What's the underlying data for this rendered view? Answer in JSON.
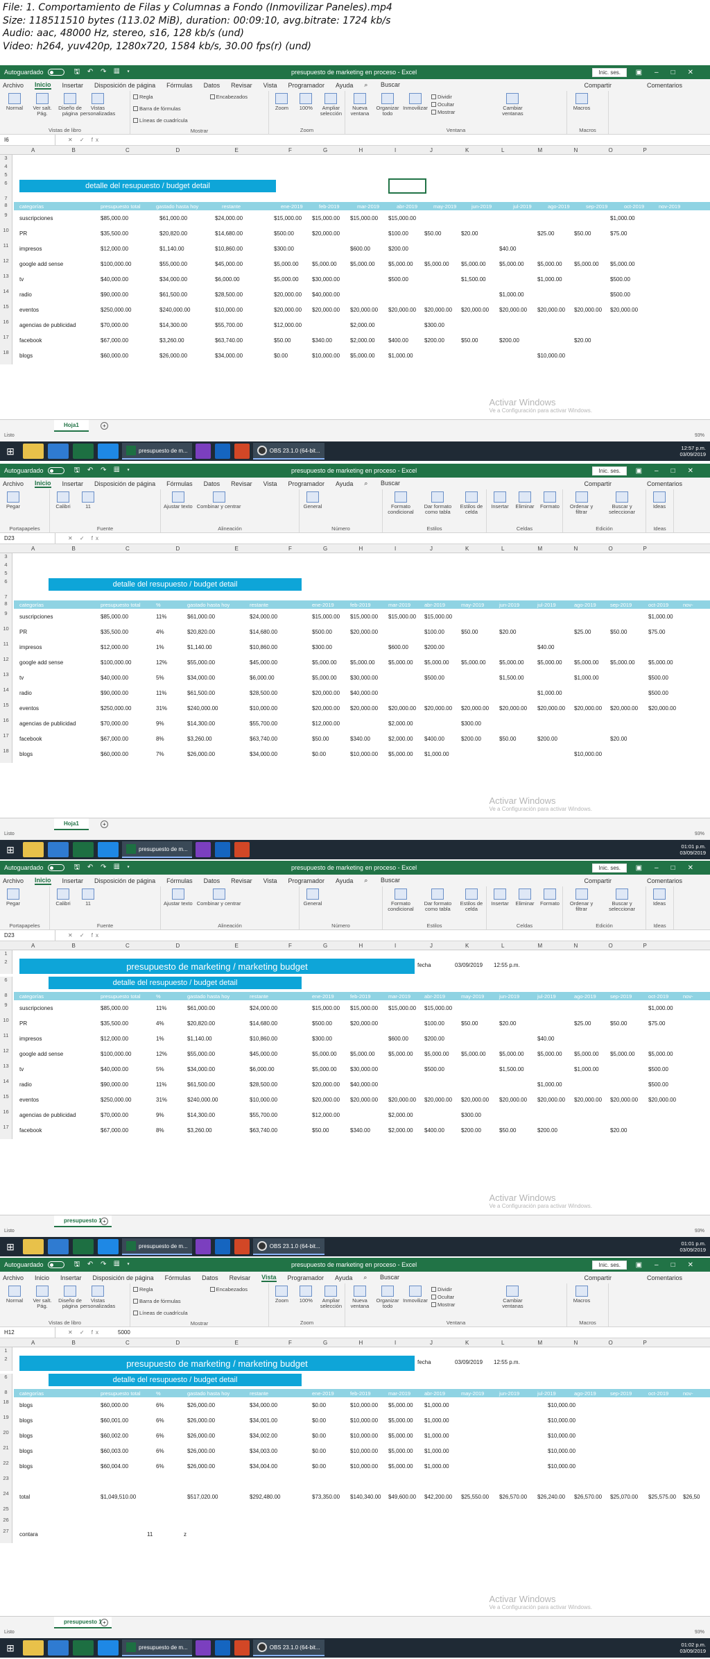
{
  "header": {
    "file": "File: 1. Comportamiento de Filas y Columnas a Fondo (Inmovilizar Paneles).mp4",
    "size": "Size: 118511510 bytes (113.02 MiB), duration: 00:09:10, avg.bitrate: 1724 kb/s",
    "audio": "Audio: aac, 48000 Hz, stereo, s16, 128 kb/s (und)",
    "video": "Video: h264, yuv420p, 1280x720, 1584 kb/s, 30.00 fps(r) (und)"
  },
  "app": {
    "autosave": "Autoguardado",
    "doc": "presupuesto de marketing en proceso - Excel",
    "signin": "Inic. ses.",
    "share": "Compartir",
    "comments": "Comentarios",
    "search": "Buscar"
  },
  "tabs": [
    "Archivo",
    "Inicio",
    "Insertar",
    "Disposición de página",
    "Fórmulas",
    "Datos",
    "Revisar",
    "Vista",
    "Programador",
    "Ayuda"
  ],
  "vista_groups": [
    "Vistas de libro",
    "Mostrar",
    "Zoom",
    "Ventana",
    "Macros"
  ],
  "vista_btns": [
    "Normal",
    "Ver salt. Pág.",
    "Diseño de página",
    "Vistas personalizadas",
    "Zoom",
    "100%",
    "Ampliar selección",
    "Nueva ventana",
    "Organizar todo",
    "Inmovilizar",
    "Cambiar ventanas",
    "Macros"
  ],
  "vista_checks": [
    "Regla",
    "Barra de fórmulas",
    "Líneas de cuadrícula",
    "Encabezados",
    "Dividir",
    "Ocultar",
    "Mostrar"
  ],
  "inicio_groups": [
    "Portapapeles",
    "Fuente",
    "Alineación",
    "Número",
    "Estilos",
    "Celdas",
    "Edición",
    "Ideas"
  ],
  "inicio_btns": [
    "Pegar",
    "Calibri",
    "11",
    "Ajustar texto",
    "Combinar y centrar",
    "General",
    "Formato condicional",
    "Dar formato como tabla",
    "Estilos de celda",
    "Insertar",
    "Eliminar",
    "Formato",
    "Ordenar y filtrar",
    "Buscar y seleccionar",
    "Ideas"
  ],
  "frames": [
    {
      "namebox": "I6",
      "formula": "",
      "tab": "Inicio"
    },
    {
      "namebox": "D23",
      "formula": "",
      "tab": "Inicio"
    },
    {
      "namebox": "D23",
      "formula": "",
      "tab": "Inicio"
    },
    {
      "namebox": "H12",
      "formula": "5000",
      "tab": "Vista"
    }
  ],
  "sheet1": "Hoja1",
  "sheet2": "presupuesto 1",
  "status": "Listo",
  "zoom": "93%",
  "watermark": {
    "title": "Activar Windows",
    "sub": "Ve a Configuración para activar Windows."
  },
  "taskbar": {
    "excel": "presupuesto de m...",
    "obs": "OBS 23.1.0 (64-bit...",
    "time": "12:57 p.m.",
    "date": "03/09/2019",
    "time2": "01:01 p.m.",
    "time3": "01:02 p.m."
  },
  "banner_main": "presupuesto de marketing / marketing budget",
  "banner_detail": "detalle del resupuesto / budget detail",
  "fecha": {
    "label": "fecha",
    "date": "03/09/2019",
    "time": "12:55 p.m."
  },
  "cols_f1": [
    "A",
    "B",
    "C",
    "D",
    "E",
    "F",
    "G",
    "H",
    "I",
    "J",
    "K",
    "L",
    "M",
    "N",
    "O",
    "P"
  ],
  "head_f1": [
    "categorías",
    "presupuesto total",
    "gastado hasta hoy",
    "restante",
    "ene-2019",
    "feb-2019",
    "mar-2019",
    "abr-2019",
    "may-2019",
    "jun-2019",
    "jul-2019",
    "ago-2019",
    "sep-2019",
    "oct-2019",
    "nov-2019"
  ],
  "head_f2": [
    "categorías",
    "presupuesto total",
    "%",
    "gastado hasta hoy",
    "restante",
    "ene-2019",
    "feb-2019",
    "mar-2019",
    "abr-2019",
    "may-2019",
    "jun-2019",
    "jul-2019",
    "ago-2019",
    "sep-2019",
    "oct-2019",
    "nov-"
  ],
  "rows": [
    [
      "9",
      "suscripciones",
      "$85,000.00",
      "11%",
      "$61,000.00",
      "$24,000.00",
      "$15,000.00",
      "$15,000.00",
      "$15,000.00",
      "$15,000.00",
      "",
      "",
      "",
      "",
      "",
      "$1,000.00"
    ],
    [
      "10",
      "PR",
      "$35,500.00",
      "4%",
      "$20,820.00",
      "$14,680.00",
      "$500.00",
      "$20,000.00",
      "",
      "$100.00",
      "$50.00",
      "$20.00",
      "",
      "$25.00",
      "$50.00",
      "$75.00"
    ],
    [
      "11",
      "impresos",
      "$12,000.00",
      "1%",
      "$1,140.00",
      "$10,860.00",
      "$300.00",
      "",
      "$600.00",
      "$200.00",
      "",
      "",
      "$40.00",
      "",
      "",
      ""
    ],
    [
      "12",
      "google add sense",
      "$100,000.00",
      "12%",
      "$55,000.00",
      "$45,000.00",
      "$5,000.00",
      "$5,000.00",
      "$5,000.00",
      "$5,000.00",
      "$5,000.00",
      "$5,000.00",
      "$5,000.00",
      "$5,000.00",
      "$5,000.00",
      "$5,000.00"
    ],
    [
      "13",
      "tv",
      "$40,000.00",
      "5%",
      "$34,000.00",
      "$6,000.00",
      "$5,000.00",
      "$30,000.00",
      "",
      "$500.00",
      "",
      "$1,500.00",
      "",
      "$1,000.00",
      "",
      "$500.00"
    ],
    [
      "14",
      "radio",
      "$90,000.00",
      "11%",
      "$61,500.00",
      "$28,500.00",
      "$20,000.00",
      "$40,000.00",
      "",
      "",
      "",
      "",
      "$1,000.00",
      "",
      "",
      "$500.00"
    ],
    [
      "15",
      "eventos",
      "$250,000.00",
      "31%",
      "$240,000.00",
      "$10,000.00",
      "$20,000.00",
      "$20,000.00",
      "$20,000.00",
      "$20,000.00",
      "$20,000.00",
      "$20,000.00",
      "$20,000.00",
      "$20,000.00",
      "$20,000.00",
      "$20,000.00"
    ],
    [
      "16",
      "agencias de publicidad",
      "$70,000.00",
      "9%",
      "$14,300.00",
      "$55,700.00",
      "$12,000.00",
      "",
      "$2,000.00",
      "",
      "$300.00",
      "",
      "",
      "",
      "",
      ""
    ],
    [
      "17",
      "facebook",
      "$67,000.00",
      "8%",
      "$3,260.00",
      "$63,740.00",
      "$50.00",
      "$340.00",
      "$2,000.00",
      "$400.00",
      "$200.00",
      "$50.00",
      "$200.00",
      "",
      "$20.00",
      ""
    ],
    [
      "18",
      "blogs",
      "$60,000.00",
      "7%",
      "$26,000.00",
      "$34,000.00",
      "$0.00",
      "$10,000.00",
      "$5,000.00",
      "$1,000.00",
      "",
      "",
      "",
      "$10,000.00",
      "",
      ""
    ]
  ],
  "rows_f4": [
    [
      "18",
      "blogs",
      "$60,000.00",
      "6%",
      "$26,000.00",
      "$34,000.00",
      "$0.00",
      "$10,000.00",
      "$5,000.00",
      "$1,000.00",
      "$10,000.00"
    ],
    [
      "19",
      "blogs",
      "$60,001.00",
      "6%",
      "$26,000.00",
      "$34,001.00",
      "$0.00",
      "$10,000.00",
      "$5,000.00",
      "$1,000.00",
      "$10,000.00"
    ],
    [
      "20",
      "blogs",
      "$60,002.00",
      "6%",
      "$26,000.00",
      "$34,002.00",
      "$0.00",
      "$10,000.00",
      "$5,000.00",
      "$1,000.00",
      "$10,000.00"
    ],
    [
      "21",
      "blogs",
      "$60,003.00",
      "6%",
      "$26,000.00",
      "$34,003.00",
      "$0.00",
      "$10,000.00",
      "$5,000.00",
      "$1,000.00",
      "$10,000.00"
    ],
    [
      "22",
      "blogs",
      "$60,004.00",
      "6%",
      "$26,000.00",
      "$34,004.00",
      "$0.00",
      "$10,000.00",
      "$5,000.00",
      "$1,000.00",
      "$10,000.00"
    ]
  ],
  "total_f4": [
    "24",
    "total",
    "$1,049,510.00",
    "",
    "$517,020.00",
    "$292,480.00",
    "$73,350.00",
    "$140,340.00",
    "$49,600.00",
    "$42,200.00",
    "$25,550.00",
    "$26,570.00",
    "$26,240.00",
    "$26,570.00",
    "$25,070.00",
    "$25,575.00",
    "$26,50"
  ],
  "contara": {
    "label": "contara",
    "value": "11",
    "z": "z"
  }
}
